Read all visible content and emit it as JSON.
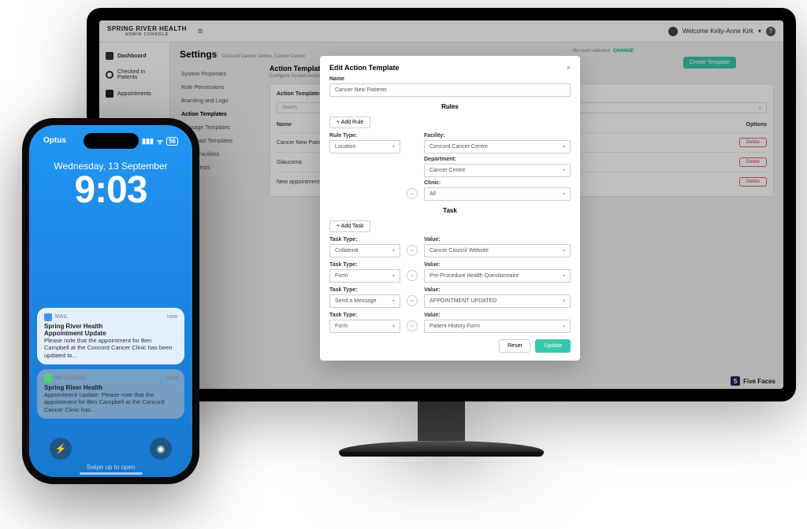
{
  "brand": {
    "name": "SPRING RIVER HEALTH",
    "sub": "ADMIN CONSOLE"
  },
  "user": {
    "greeting": "Welcome Kelly-Anne Kirk"
  },
  "sidebar": {
    "items": [
      {
        "label": "Dashboard"
      },
      {
        "label": "Checked in Patients"
      },
      {
        "label": "Appointments"
      }
    ]
  },
  "settings": {
    "title": "Settings",
    "crumb": "Concord Cancer Centre, Cancer Centre",
    "no_room": "No room selected",
    "change": "CHANGE",
    "create_btn": "Create Template",
    "nav": [
      "System Properties",
      "Role Permissions",
      "Branding and Logo",
      "Action Templates",
      "Message Templates",
      "Broadcast Templates",
      "RACF Facilities",
      "Info & Tests"
    ],
    "nav_selected": "Action Templates",
    "panel_title": "Action Templates",
    "panel_sub": "Configure System Action Templates",
    "tbl_header": "Action Templates",
    "search_ph": "Search",
    "col_name": "Name",
    "col_options": "Options",
    "rows": [
      "Cancer New Patients",
      "Glaucoma",
      "New appointment"
    ],
    "delete_label": "Delete"
  },
  "modal": {
    "title": "Edit Action Template",
    "name_label": "Name",
    "name_value": "Cancer New Patients",
    "rules_header": "Rules",
    "add_rule": "+ Add Rule",
    "rule_type_label": "Rule Type:",
    "rule_type_value": "Location",
    "facility_label": "Facility:",
    "facility_value": "Concord Cancer Centre",
    "department_label": "Department:",
    "department_value": "Cancer Centre",
    "clinic_label": "Clinic:",
    "clinic_value": "All",
    "task_header": "Task",
    "add_task": "+ Add Task",
    "task_type_label": "Task Type:",
    "value_label": "Value:",
    "tasks": [
      {
        "type": "Collateral",
        "value": "Cancer Council Website"
      },
      {
        "type": "Form",
        "value": "Pre-Procedure Health Questionnaire"
      },
      {
        "type": "Send a Message",
        "value": "APPOINTMENT UPDATED"
      },
      {
        "type": "Form",
        "value": "Patient History Form"
      }
    ],
    "reset": "Reset",
    "update": "Update"
  },
  "footer_brand": "Five Faces",
  "phone": {
    "carrier": "Optus",
    "battery": "56",
    "date": "Wednesday, 13 September",
    "time": "9:03",
    "swipe": "Swipe up to open",
    "notifs": [
      {
        "app": "MAIL",
        "time": "now",
        "from": "Spring River Health",
        "title": "Appointment Update",
        "body": "Please note that the appointment for Ben Campbell at the Concord Cancer Clinic has been updated to..."
      },
      {
        "app": "MESSAGES",
        "time": "now",
        "from": "Spring River Health",
        "body": "Appointment Update: Please note that the appointment for Ben Campbell at the Concord Cancer Clinic has..."
      }
    ]
  }
}
